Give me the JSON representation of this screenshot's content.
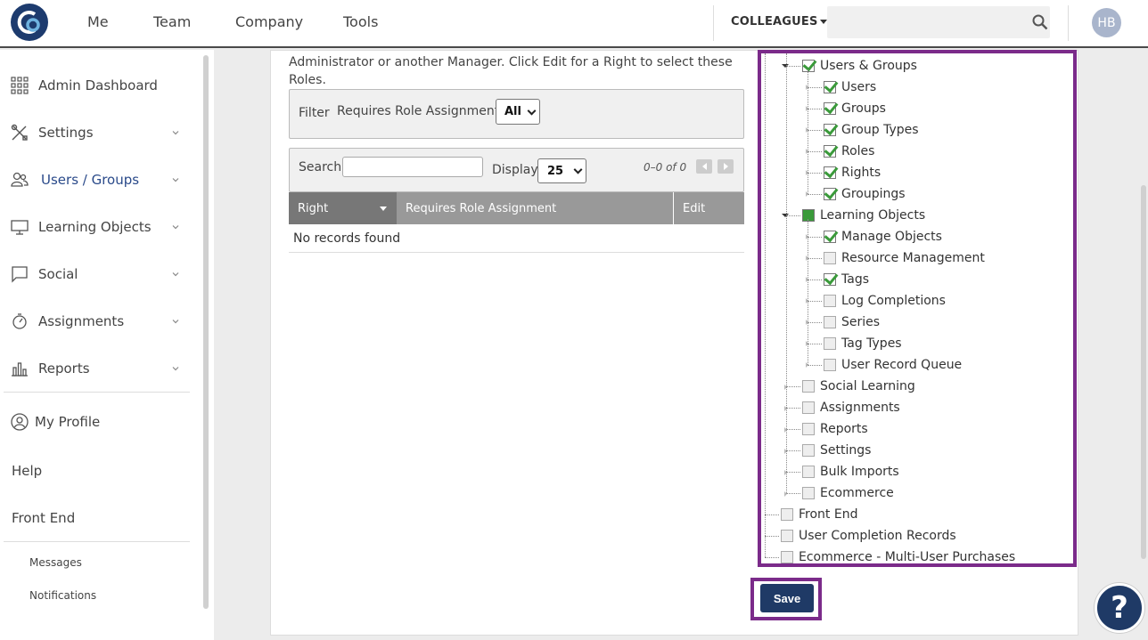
{
  "nav": {
    "items": [
      "Me",
      "Team",
      "Company",
      "Tools"
    ],
    "colleagues_label": "COLLEAGUES",
    "search_placeholder": "",
    "avatar_initials": "HB"
  },
  "sidebar": {
    "items": [
      {
        "label": "Admin Dashboard",
        "icon": "grid-icon"
      },
      {
        "label": "Settings",
        "icon": "tools-icon"
      },
      {
        "label": "Users / Groups",
        "icon": "users-icon"
      },
      {
        "label": "Learning Objects",
        "icon": "monitor-icon"
      },
      {
        "label": "Social",
        "icon": "chat-icon"
      },
      {
        "label": "Assignments",
        "icon": "timer-icon"
      },
      {
        "label": "Reports",
        "icon": "bar-chart-icon"
      }
    ],
    "my_profile": "My Profile",
    "help": "Help",
    "front_end": "Front End",
    "messages": "Messages",
    "notifications": "Notifications"
  },
  "main": {
    "intro_text": "Administrator or another Manager. Click Edit for a Right to select these Roles.",
    "filter_label": "Filter",
    "filter_requires": "Requires Role Assignment",
    "filter_value": "All",
    "search_label": "Search",
    "search_value": "",
    "display_label": "Display",
    "display_value": "25",
    "paging_text": "0–0 of 0",
    "columns": [
      "Right",
      "Requires Role Assignment",
      "Edit"
    ],
    "empty_text": "No records found"
  },
  "tree": [
    {
      "label": "Users & Groups",
      "state": "checked",
      "level": 1
    },
    {
      "label": "Users",
      "state": "checked",
      "level": 2
    },
    {
      "label": "Groups",
      "state": "checked",
      "level": 2
    },
    {
      "label": "Group Types",
      "state": "checked",
      "level": 2
    },
    {
      "label": "Roles",
      "state": "checked",
      "level": 2
    },
    {
      "label": "Rights",
      "state": "checked",
      "level": 2
    },
    {
      "label": "Groupings",
      "state": "checked",
      "level": 2
    },
    {
      "label": "Learning Objects",
      "state": "partial",
      "level": 1
    },
    {
      "label": "Manage Objects",
      "state": "checked",
      "level": 2
    },
    {
      "label": "Resource Management",
      "state": "unchecked",
      "level": 2
    },
    {
      "label": "Tags",
      "state": "checked",
      "level": 2
    },
    {
      "label": "Log Completions",
      "state": "unchecked",
      "level": 2
    },
    {
      "label": "Series",
      "state": "unchecked",
      "level": 2
    },
    {
      "label": "Tag Types",
      "state": "unchecked",
      "level": 2
    },
    {
      "label": "User Record Queue",
      "state": "unchecked",
      "level": 2
    },
    {
      "label": "Social Learning",
      "state": "unchecked",
      "level": 1
    },
    {
      "label": "Assignments",
      "state": "unchecked",
      "level": 1
    },
    {
      "label": "Reports",
      "state": "unchecked",
      "level": 1
    },
    {
      "label": "Settings",
      "state": "unchecked",
      "level": 1
    },
    {
      "label": "Bulk Imports",
      "state": "unchecked",
      "level": 1
    },
    {
      "label": "Ecommerce",
      "state": "unchecked",
      "level": 1
    },
    {
      "label": "Front End",
      "state": "unchecked",
      "level": 0
    },
    {
      "label": "User Completion Records",
      "state": "unchecked",
      "level": 0
    },
    {
      "label": "Ecommerce - Multi-User Purchases",
      "state": "unchecked",
      "level": 0
    }
  ],
  "save_label": "Save",
  "help_glyph": "?",
  "colors": {
    "brand": "#1f3a66",
    "highlight": "#7b2b8a",
    "check": "#3a9a3a",
    "table_header_dark": "#777777",
    "table_header": "#999999"
  }
}
